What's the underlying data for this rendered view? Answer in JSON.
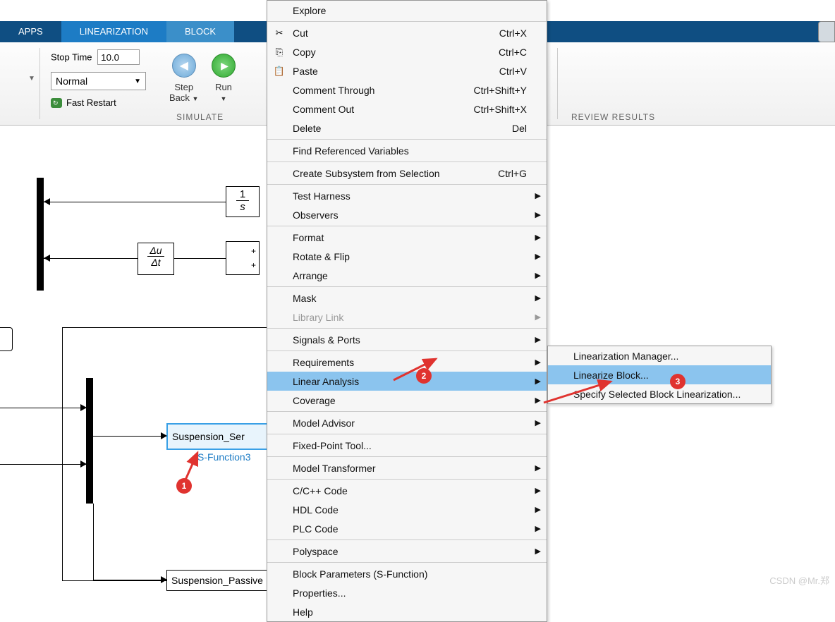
{
  "tabs": {
    "apps": "APPS",
    "linearization": "LINEARIZATION",
    "block": "BLOCK"
  },
  "toolbar": {
    "stoptime_label": "Stop Time",
    "stoptime_value": "10.0",
    "mode": "Normal",
    "fast_restart": "Fast Restart",
    "step_back": "Step\nBack",
    "run": "Run",
    "simulate_section": "SIMULATE",
    "review_section": "REVIEW RESULTS"
  },
  "context_menu": [
    {
      "label": "Explore"
    },
    {
      "sep": true
    },
    {
      "label": "Cut",
      "icon": "✂",
      "shortcut": "Ctrl+X"
    },
    {
      "label": "Copy",
      "icon": "⎘",
      "shortcut": "Ctrl+C"
    },
    {
      "label": "Paste",
      "icon": "📋",
      "shortcut": "Ctrl+V"
    },
    {
      "label": "Comment Through",
      "shortcut": "Ctrl+Shift+Y"
    },
    {
      "label": "Comment Out",
      "shortcut": "Ctrl+Shift+X"
    },
    {
      "label": "Delete",
      "shortcut": "Del"
    },
    {
      "sep": true
    },
    {
      "label": "Find Referenced Variables"
    },
    {
      "sep": true
    },
    {
      "label": "Create Subsystem from Selection",
      "shortcut": "Ctrl+G"
    },
    {
      "sep": true
    },
    {
      "label": "Test Harness",
      "sub": true
    },
    {
      "label": "Observers",
      "sub": true
    },
    {
      "sep": true
    },
    {
      "label": "Format",
      "sub": true
    },
    {
      "label": "Rotate & Flip",
      "sub": true
    },
    {
      "label": "Arrange",
      "sub": true
    },
    {
      "sep": true
    },
    {
      "label": "Mask",
      "sub": true
    },
    {
      "label": "Library Link",
      "sub": true,
      "disabled": true
    },
    {
      "sep": true
    },
    {
      "label": "Signals & Ports",
      "sub": true
    },
    {
      "sep": true
    },
    {
      "label": "Requirements",
      "sub": true
    },
    {
      "label": "Linear Analysis",
      "sub": true,
      "hover": true
    },
    {
      "label": "Coverage",
      "sub": true
    },
    {
      "sep": true
    },
    {
      "label": "Model Advisor",
      "sub": true
    },
    {
      "sep": true
    },
    {
      "label": "Fixed-Point Tool..."
    },
    {
      "sep": true
    },
    {
      "label": "Model Transformer",
      "sub": true
    },
    {
      "sep": true
    },
    {
      "label": "C/C++ Code",
      "sub": true
    },
    {
      "label": "HDL Code",
      "sub": true
    },
    {
      "label": "PLC Code",
      "sub": true
    },
    {
      "sep": true
    },
    {
      "label": "Polyspace",
      "sub": true
    },
    {
      "sep": true
    },
    {
      "label": "Block Parameters (S-Function)"
    },
    {
      "label": "Properties..."
    },
    {
      "label": "Help"
    }
  ],
  "submenu": [
    {
      "label": "Linearization Manager..."
    },
    {
      "label": "Linearize Block...",
      "hover": true
    },
    {
      "label": "Specify Selected Block Linearization..."
    }
  ],
  "diagram": {
    "integrator_num": "1",
    "integrator_den": "s",
    "deriv_num": "Δu",
    "deriv_den": "Δt",
    "sfunc_block": "Suspension_Ser",
    "sfunc_label": "S-Function3",
    "passive_block": "Suspension_Passive"
  },
  "callouts": {
    "c1": "1",
    "c2": "2",
    "c3": "3"
  },
  "watermark": "CSDN @Mr.郑"
}
